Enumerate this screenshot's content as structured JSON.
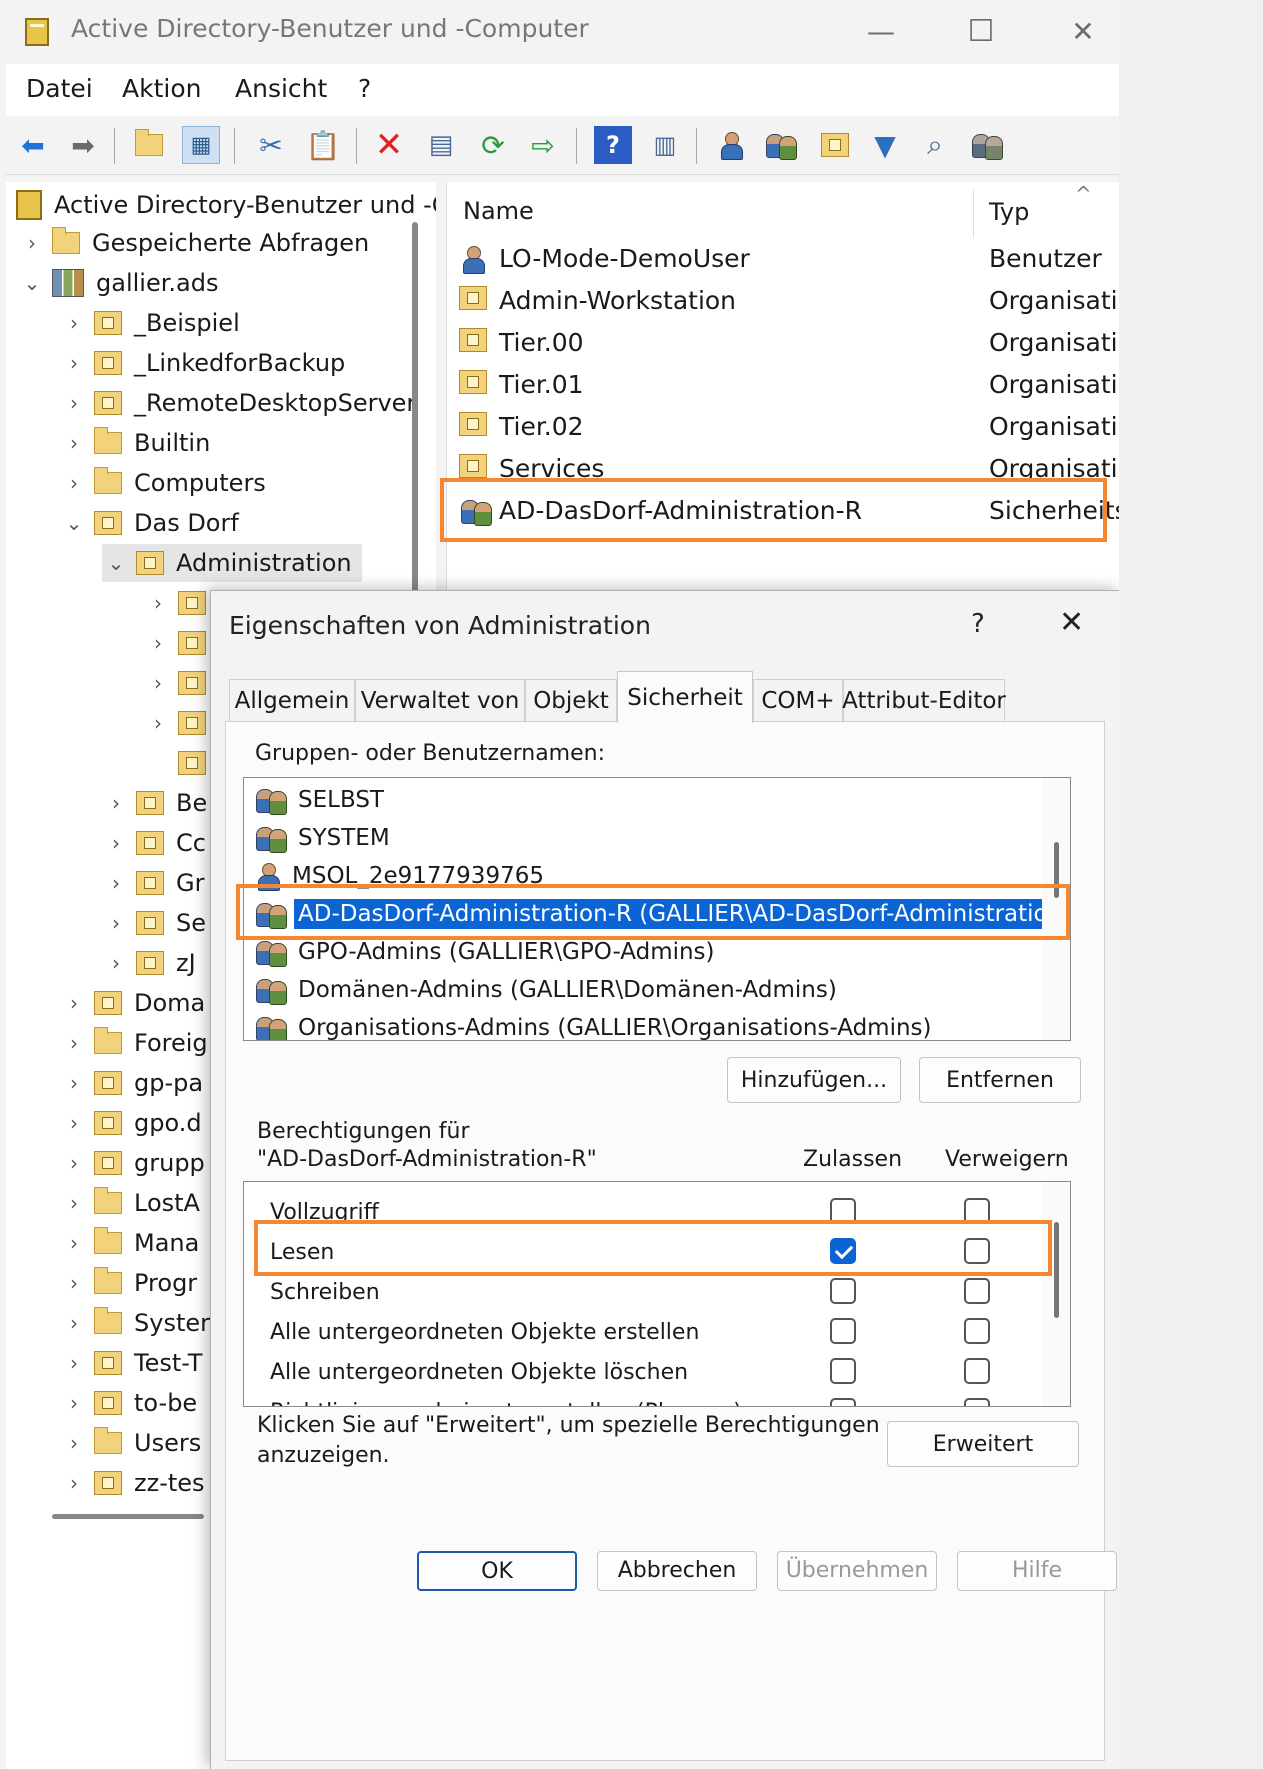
{
  "window": {
    "title": "Active Directory-Benutzer und -Computer",
    "controls": {
      "minimize": "—",
      "maximize": "☐",
      "close": "✕"
    }
  },
  "menu": [
    "Datei",
    "Aktion",
    "Ansicht",
    "?"
  ],
  "toolbar": {
    "buttons": [
      "back-icon",
      "forward-icon",
      "up-folder-icon",
      "show-tree-icon",
      "cut-icon",
      "paste-icon",
      "delete-icon",
      "properties-icon",
      "refresh-icon",
      "export-icon",
      "help-icon",
      "console-icon",
      "new-user-icon",
      "new-group-icon",
      "new-ou-icon",
      "filter-icon",
      "find-icon",
      "add-to-group-icon"
    ]
  },
  "tree": {
    "root": "Active Directory-Benutzer und -Computer",
    "items": [
      {
        "label": "Gespeicherte Abfragen",
        "chev": "›",
        "icon": "folder"
      },
      {
        "label": "gallier.ads",
        "chev": "⌄",
        "icon": "domain"
      },
      {
        "label": "_Beispiel",
        "chev": "›",
        "icon": "ou"
      },
      {
        "label": "_LinkedforBackup",
        "chev": "›",
        "icon": "ou"
      },
      {
        "label": "_RemoteDesktopServer",
        "chev": "›",
        "icon": "ou"
      },
      {
        "label": "Builtin",
        "chev": "›",
        "icon": "folder"
      },
      {
        "label": "Computers",
        "chev": "›",
        "icon": "folder"
      },
      {
        "label": "Das Dorf",
        "chev": "⌄",
        "icon": "ou"
      },
      {
        "label": "Administration",
        "chev": "⌄",
        "icon": "ou"
      },
      {
        "label": "",
        "chev": "›",
        "icon": "ou"
      },
      {
        "label": "",
        "chev": "›",
        "icon": "ou"
      },
      {
        "label": "",
        "chev": "›",
        "icon": "ou"
      },
      {
        "label": "",
        "chev": "›",
        "icon": "ou"
      },
      {
        "label": "",
        "chev": "",
        "icon": "ou"
      },
      {
        "label": "Be",
        "chev": "›",
        "icon": "ou"
      },
      {
        "label": "Cc",
        "chev": "›",
        "icon": "ou"
      },
      {
        "label": "Gr",
        "chev": "›",
        "icon": "ou"
      },
      {
        "label": "Se",
        "chev": "›",
        "icon": "ou"
      },
      {
        "label": "zJ",
        "chev": "›",
        "icon": "ou"
      },
      {
        "label": "Doma",
        "chev": "›",
        "icon": "ou"
      },
      {
        "label": "Foreig",
        "chev": "›",
        "icon": "folder"
      },
      {
        "label": "gp-pa",
        "chev": "›",
        "icon": "ou"
      },
      {
        "label": "gpo.d",
        "chev": "›",
        "icon": "ou"
      },
      {
        "label": "grupp",
        "chev": "›",
        "icon": "ou"
      },
      {
        "label": "LostA",
        "chev": "›",
        "icon": "folder"
      },
      {
        "label": "Mana",
        "chev": "›",
        "icon": "folder"
      },
      {
        "label": "Progr",
        "chev": "›",
        "icon": "folder"
      },
      {
        "label": "Syster",
        "chev": "›",
        "icon": "folder"
      },
      {
        "label": "Test-T",
        "chev": "›",
        "icon": "ou"
      },
      {
        "label": "to-be",
        "chev": "›",
        "icon": "ou"
      },
      {
        "label": "Users",
        "chev": "›",
        "icon": "folder"
      },
      {
        "label": "zz-tes",
        "chev": "›",
        "icon": "ou"
      }
    ]
  },
  "list": {
    "columns": [
      "Name",
      "Typ"
    ],
    "scroll_up": "^",
    "rows": [
      {
        "name": "LO-Mode-DemoUser",
        "type": "Benutzer",
        "icon": "user"
      },
      {
        "name": "Admin-Workstation",
        "type": "Organisationseinheit",
        "icon": "ou"
      },
      {
        "name": "Tier.00",
        "type": "Organisationseinheit",
        "icon": "ou"
      },
      {
        "name": "Tier.01",
        "type": "Organisationseinheit",
        "icon": "ou"
      },
      {
        "name": "Tier.02",
        "type": "Organisationseinheit",
        "icon": "ou"
      },
      {
        "name": "Services",
        "type": "Organisationseinheit",
        "icon": "ou"
      },
      {
        "name": "AD-DasDorf-Administration-R",
        "type": "Sicherheitsgruppe",
        "icon": "group"
      }
    ]
  },
  "dialog": {
    "title": "Eigenschaften von Administration",
    "help": "?",
    "close": "✕",
    "tabs": [
      "Allgemein",
      "Verwaltet von",
      "Objekt",
      "Sicherheit",
      "COM+",
      "Attribut-Editor"
    ],
    "active_tab": "Sicherheit",
    "groups_label": "Gruppen- oder Benutzernamen:",
    "principals": [
      {
        "label": "SELBST",
        "icon": "group"
      },
      {
        "label": "SYSTEM",
        "icon": "group"
      },
      {
        "label": "MSOL_2e9177939765",
        "icon": "user"
      },
      {
        "label": "AD-DasDorf-Administration-R (GALLIER\\AD-DasDorf-Administration-...",
        "icon": "group",
        "selected": true
      },
      {
        "label": "GPO-Admins (GALLIER\\GPO-Admins)",
        "icon": "group"
      },
      {
        "label": "Domänen-Admins (GALLIER\\Domänen-Admins)",
        "icon": "group"
      },
      {
        "label": "Organisations-Admins (GALLIER\\Organisations-Admins)",
        "icon": "group"
      }
    ],
    "add_button": "Hinzufügen...",
    "remove_button": "Entfernen",
    "perm_label_line1": "Berechtigungen für",
    "perm_label_line2": "\"AD-DasDorf-Administration-R\"",
    "allow_header": "Zulassen",
    "deny_header": "Verweigern",
    "permissions": [
      {
        "name": "Vollzugriff",
        "allow": false,
        "deny": false
      },
      {
        "name": "Lesen",
        "allow": true,
        "deny": false
      },
      {
        "name": "Schreiben",
        "allow": false,
        "deny": false
      },
      {
        "name": "Alle untergeordneten Objekte erstellen",
        "allow": false,
        "deny": false
      },
      {
        "name": "Alle untergeordneten Objekte löschen",
        "allow": false,
        "deny": false
      },
      {
        "name": "Richtlinienergebnissatz erstellen (Planung)",
        "allow": false,
        "deny": false
      }
    ],
    "advanced_hint_line1": "Klicken Sie auf \"Erweitert\", um spezielle Berechtigungen",
    "advanced_hint_line2": "anzuzeigen.",
    "advanced_button": "Erweitert",
    "footer_buttons": [
      "OK",
      "Abbrechen",
      "Übernehmen",
      "Hilfe"
    ]
  },
  "colors": {
    "highlight": "#f7862e",
    "selection": "#0a64d4"
  }
}
